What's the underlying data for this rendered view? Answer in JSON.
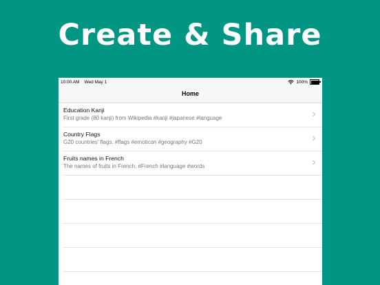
{
  "headline": "Create & Share",
  "status_bar": {
    "time": "10:00 AM",
    "date": "Wed May 1",
    "battery": "100%"
  },
  "nav": {
    "title": "Home"
  },
  "rows": [
    {
      "title": "Education Kanji",
      "subtitle": "First grade (80 kanji) from Wikipedia #kanji #japanese #language"
    },
    {
      "title": "Country Flags",
      "subtitle": "G20 countries' flags. #flags #emoticon #geography #G20"
    },
    {
      "title": "Fruits names in French",
      "subtitle": "The names of fruits in French. #French #language #words"
    }
  ],
  "icons": {
    "wifi": "wifi-icon",
    "battery": "battery-icon",
    "chevron": "chevron-right-icon"
  },
  "colors": {
    "background": "#009683",
    "headline": "#ffffff"
  }
}
